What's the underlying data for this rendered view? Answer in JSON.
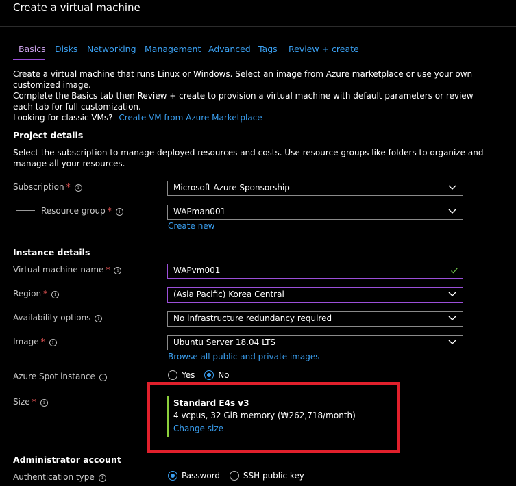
{
  "page": {
    "title": "Create a virtual machine"
  },
  "tabs": [
    {
      "label": "Basics"
    },
    {
      "label": "Disks"
    },
    {
      "label": "Networking"
    },
    {
      "label": "Management"
    },
    {
      "label": "Advanced"
    },
    {
      "label": "Tags"
    },
    {
      "label": "Review + create"
    }
  ],
  "intro": {
    "line1": "Create a virtual machine that runs Linux or Windows. Select an image from Azure marketplace or use your own customized image.",
    "line2": "Complete the Basics tab then Review + create to provision a virtual machine with default parameters or review each tab for full customization.",
    "classic_prefix": "Looking for classic VMs?",
    "classic_link": "Create VM from Azure Marketplace"
  },
  "project": {
    "title": "Project details",
    "desc": "Select the subscription to manage deployed resources and costs. Use resource groups like folders to organize and manage all your resources.",
    "subscription_label": "Subscription",
    "subscription_value": "Microsoft Azure Sponsorship",
    "resource_group_label": "Resource group",
    "resource_group_value": "WAPman001",
    "create_new": "Create new"
  },
  "instance": {
    "title": "Instance details",
    "vm_name_label": "Virtual machine name",
    "vm_name_value": "WAPvm001",
    "region_label": "Region",
    "region_value": "(Asia Pacific) Korea Central",
    "availability_label": "Availability options",
    "availability_value": "No infrastructure redundancy required",
    "image_label": "Image",
    "image_value": "Ubuntu Server 18.04 LTS",
    "browse_images": "Browse all public and private images",
    "spot_label": "Azure Spot instance",
    "spot_yes": "Yes",
    "spot_no": "No",
    "size_label": "Size",
    "size_name": "Standard E4s v3",
    "size_spec": "4 vcpus, 32 GiB memory (₩262,718/month)",
    "change_size": "Change size"
  },
  "admin": {
    "title": "Administrator account",
    "auth_label": "Authentication type",
    "auth_password": "Password",
    "auth_ssh": "SSH public key"
  },
  "colors": {
    "accent": "#3a9ff0",
    "active_tab": "#9b4fd8",
    "required": "#f25858",
    "highlight": "#e0202c",
    "size_bar": "#8ccf3c"
  }
}
